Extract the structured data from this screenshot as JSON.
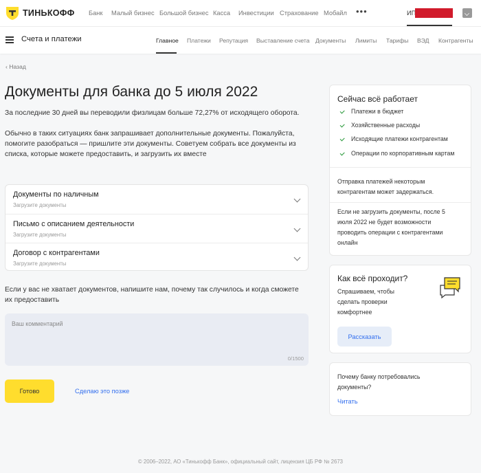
{
  "topbar": {
    "logo_text": "ТИНЬКОФФ",
    "nav": [
      "Банк",
      "Малый бизнес",
      "Большой бизнес",
      "Касса",
      "Инвестиции",
      "Страхование",
      "Мобайл"
    ],
    "more": "•••",
    "account_label": "ИП",
    "colors": {
      "accent": "#ffdd2d",
      "link": "#336fee",
      "redaction": "#d11b2b"
    }
  },
  "subbar": {
    "title": "Счета и платежи",
    "nav": [
      "Главное",
      "Платежи",
      "Репутация",
      "Выставление счета",
      "Документы",
      "Лимиты",
      "Тарифы",
      "ВЭД",
      "Контрагенты"
    ],
    "active": "Главное"
  },
  "main": {
    "back": "Назад",
    "title": "Документы для банка до 5 июля 2022",
    "intro": "За последние 30 дней вы переводили физлицам больше 72,27% от исходящего оборота.",
    "explain_lines": [
      "Обычно в таких ситуациях банк запрашивает дополнительные документы. Пожалуйста,",
      "помогите разобраться — пришлите эти документы. Советуем собрать все документы из",
      "списка, которые можете предоставить, и  загрузить их вместе"
    ],
    "documents": [
      {
        "title": "Документы по наличным",
        "subtitle": "Загрузите документы"
      },
      {
        "title": "Письмо с описанием деятельности",
        "subtitle": "Загрузите документы"
      },
      {
        "title": "Договор с контрагентами",
        "subtitle": "Загрузите документы"
      }
    ],
    "comment_prompt_lines": [
      "Если у вас не хватает документов, напишите нам, почему так случилось и когда сможете",
      "их предоставить"
    ],
    "comment": {
      "placeholder": "Ваш комментарий",
      "value": "",
      "counter": "0/1500"
    },
    "submit_label": "Готово",
    "later_label": "Сделаю это позже"
  },
  "status_card": {
    "title": "Сейчас всё работает",
    "items": [
      "Платежи в бюджет",
      "Хозяйственные расходы",
      "Исходящие платежи контрагентам",
      "Операции по корпоративным картам"
    ],
    "note1_lines": [
      "Отправка платежей некоторым",
      "контрагентам может задержаться."
    ],
    "note2_lines": [
      "Если не загрузить документы, после 5",
      "июля 2022 не будет возможности",
      "проводить операции с контрагентами",
      "онлайн"
    ]
  },
  "process_card": {
    "title": "Как всё проходит?",
    "text_lines": [
      "Спрашиваем, чтобы",
      "сделать проверки",
      "комфортнее"
    ],
    "button": "Рассказать",
    "icon": "chat-bubbles-icon"
  },
  "why_card": {
    "text_lines": [
      "Почему банку потребовались",
      "документы?"
    ],
    "link": "Читать"
  },
  "footer": "© 2006–2022, АО «Тинькофф Банк», официальный сайт, лицензия ЦБ РФ № 2673"
}
